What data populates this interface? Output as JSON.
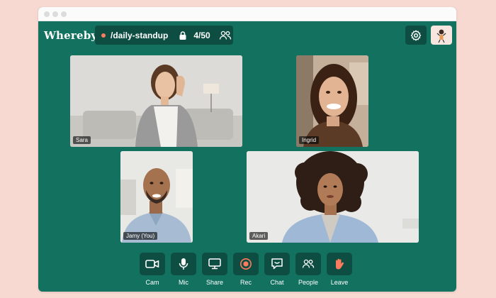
{
  "app": {
    "logo": "Whereby"
  },
  "room": {
    "name": "/daily-standup",
    "count": "4/50",
    "locked": true
  },
  "participants": [
    {
      "name": "Sara"
    },
    {
      "name": "Ingrid"
    },
    {
      "name": "Jamy (You)"
    },
    {
      "name": "Akari"
    }
  ],
  "controls": [
    {
      "label": "Cam",
      "icon": "camera-icon"
    },
    {
      "label": "Mic",
      "icon": "microphone-icon"
    },
    {
      "label": "Share",
      "icon": "screen-share-icon"
    },
    {
      "label": "Rec",
      "icon": "record-icon"
    },
    {
      "label": "Chat",
      "icon": "chat-icon"
    },
    {
      "label": "People",
      "icon": "people-icon"
    },
    {
      "label": "Leave",
      "icon": "wave-hand-icon"
    }
  ],
  "colors": {
    "background": "#f7d9d1",
    "app_green": "#137160",
    "button_dark": "#0e4d42",
    "accent_coral": "#ff7b5e"
  }
}
